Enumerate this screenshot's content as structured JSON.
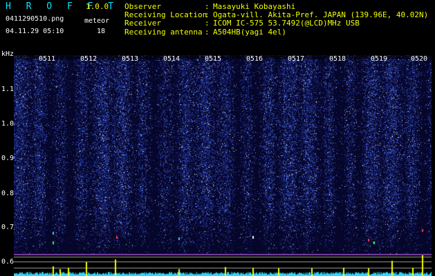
{
  "app": {
    "title": "H R O F F T",
    "version": "1.0.0"
  },
  "file": {
    "name": "0411290510.png",
    "datetime": "04.11.29 05:10"
  },
  "meteor": {
    "label": "meteor",
    "count": "18"
  },
  "station": [
    {
      "label": "Observer",
      "sep": ":",
      "value": "Masayuki Kobayashi"
    },
    {
      "label": "Receiving Location",
      "sep": ":",
      "value": "Ogata-vill. Akita-Pref. JAPAN (139.96E, 40.02N)"
    },
    {
      "label": "Receiver",
      "sep": ":",
      "value": "ICOM IC-575 53.7492(@LCD)MHz USB"
    },
    {
      "label": "Receiving antenna",
      "sep": ":",
      "value": "A504HB(yagi 4el)"
    }
  ],
  "axis": {
    "unit": "kHz",
    "yticks": [
      "1.1",
      "1.0",
      "0.9",
      "0.8",
      "0.7",
      "0.6"
    ],
    "xticks": [
      "0511",
      "0512",
      "0513",
      "0514",
      "0515",
      "0516",
      "0517",
      "0518",
      "0519",
      "0520"
    ]
  },
  "colors": {
    "title": "#00e8ff",
    "accent": "#f2ff00",
    "spectrum": "#2a6cff",
    "background": "#000000"
  }
}
